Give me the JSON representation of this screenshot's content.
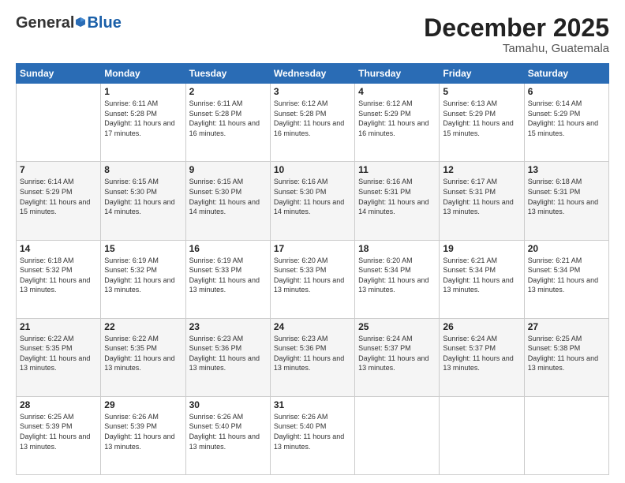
{
  "header": {
    "logo_general": "General",
    "logo_blue": "Blue",
    "month_title": "December 2025",
    "location": "Tamahu, Guatemala"
  },
  "days_of_week": [
    "Sunday",
    "Monday",
    "Tuesday",
    "Wednesday",
    "Thursday",
    "Friday",
    "Saturday"
  ],
  "weeks": [
    [
      {
        "day": "",
        "sunrise": "",
        "sunset": "",
        "daylight": ""
      },
      {
        "day": "1",
        "sunrise": "Sunrise: 6:11 AM",
        "sunset": "Sunset: 5:28 PM",
        "daylight": "Daylight: 11 hours and 17 minutes."
      },
      {
        "day": "2",
        "sunrise": "Sunrise: 6:11 AM",
        "sunset": "Sunset: 5:28 PM",
        "daylight": "Daylight: 11 hours and 16 minutes."
      },
      {
        "day": "3",
        "sunrise": "Sunrise: 6:12 AM",
        "sunset": "Sunset: 5:28 PM",
        "daylight": "Daylight: 11 hours and 16 minutes."
      },
      {
        "day": "4",
        "sunrise": "Sunrise: 6:12 AM",
        "sunset": "Sunset: 5:29 PM",
        "daylight": "Daylight: 11 hours and 16 minutes."
      },
      {
        "day": "5",
        "sunrise": "Sunrise: 6:13 AM",
        "sunset": "Sunset: 5:29 PM",
        "daylight": "Daylight: 11 hours and 15 minutes."
      },
      {
        "day": "6",
        "sunrise": "Sunrise: 6:14 AM",
        "sunset": "Sunset: 5:29 PM",
        "daylight": "Daylight: 11 hours and 15 minutes."
      }
    ],
    [
      {
        "day": "7",
        "sunrise": "Sunrise: 6:14 AM",
        "sunset": "Sunset: 5:29 PM",
        "daylight": "Daylight: 11 hours and 15 minutes."
      },
      {
        "day": "8",
        "sunrise": "Sunrise: 6:15 AM",
        "sunset": "Sunset: 5:30 PM",
        "daylight": "Daylight: 11 hours and 14 minutes."
      },
      {
        "day": "9",
        "sunrise": "Sunrise: 6:15 AM",
        "sunset": "Sunset: 5:30 PM",
        "daylight": "Daylight: 11 hours and 14 minutes."
      },
      {
        "day": "10",
        "sunrise": "Sunrise: 6:16 AM",
        "sunset": "Sunset: 5:30 PM",
        "daylight": "Daylight: 11 hours and 14 minutes."
      },
      {
        "day": "11",
        "sunrise": "Sunrise: 6:16 AM",
        "sunset": "Sunset: 5:31 PM",
        "daylight": "Daylight: 11 hours and 14 minutes."
      },
      {
        "day": "12",
        "sunrise": "Sunrise: 6:17 AM",
        "sunset": "Sunset: 5:31 PM",
        "daylight": "Daylight: 11 hours and 13 minutes."
      },
      {
        "day": "13",
        "sunrise": "Sunrise: 6:18 AM",
        "sunset": "Sunset: 5:31 PM",
        "daylight": "Daylight: 11 hours and 13 minutes."
      }
    ],
    [
      {
        "day": "14",
        "sunrise": "Sunrise: 6:18 AM",
        "sunset": "Sunset: 5:32 PM",
        "daylight": "Daylight: 11 hours and 13 minutes."
      },
      {
        "day": "15",
        "sunrise": "Sunrise: 6:19 AM",
        "sunset": "Sunset: 5:32 PM",
        "daylight": "Daylight: 11 hours and 13 minutes."
      },
      {
        "day": "16",
        "sunrise": "Sunrise: 6:19 AM",
        "sunset": "Sunset: 5:33 PM",
        "daylight": "Daylight: 11 hours and 13 minutes."
      },
      {
        "day": "17",
        "sunrise": "Sunrise: 6:20 AM",
        "sunset": "Sunset: 5:33 PM",
        "daylight": "Daylight: 11 hours and 13 minutes."
      },
      {
        "day": "18",
        "sunrise": "Sunrise: 6:20 AM",
        "sunset": "Sunset: 5:34 PM",
        "daylight": "Daylight: 11 hours and 13 minutes."
      },
      {
        "day": "19",
        "sunrise": "Sunrise: 6:21 AM",
        "sunset": "Sunset: 5:34 PM",
        "daylight": "Daylight: 11 hours and 13 minutes."
      },
      {
        "day": "20",
        "sunrise": "Sunrise: 6:21 AM",
        "sunset": "Sunset: 5:34 PM",
        "daylight": "Daylight: 11 hours and 13 minutes."
      }
    ],
    [
      {
        "day": "21",
        "sunrise": "Sunrise: 6:22 AM",
        "sunset": "Sunset: 5:35 PM",
        "daylight": "Daylight: 11 hours and 13 minutes."
      },
      {
        "day": "22",
        "sunrise": "Sunrise: 6:22 AM",
        "sunset": "Sunset: 5:35 PM",
        "daylight": "Daylight: 11 hours and 13 minutes."
      },
      {
        "day": "23",
        "sunrise": "Sunrise: 6:23 AM",
        "sunset": "Sunset: 5:36 PM",
        "daylight": "Daylight: 11 hours and 13 minutes."
      },
      {
        "day": "24",
        "sunrise": "Sunrise: 6:23 AM",
        "sunset": "Sunset: 5:36 PM",
        "daylight": "Daylight: 11 hours and 13 minutes."
      },
      {
        "day": "25",
        "sunrise": "Sunrise: 6:24 AM",
        "sunset": "Sunset: 5:37 PM",
        "daylight": "Daylight: 11 hours and 13 minutes."
      },
      {
        "day": "26",
        "sunrise": "Sunrise: 6:24 AM",
        "sunset": "Sunset: 5:37 PM",
        "daylight": "Daylight: 11 hours and 13 minutes."
      },
      {
        "day": "27",
        "sunrise": "Sunrise: 6:25 AM",
        "sunset": "Sunset: 5:38 PM",
        "daylight": "Daylight: 11 hours and 13 minutes."
      }
    ],
    [
      {
        "day": "28",
        "sunrise": "Sunrise: 6:25 AM",
        "sunset": "Sunset: 5:39 PM",
        "daylight": "Daylight: 11 hours and 13 minutes."
      },
      {
        "day": "29",
        "sunrise": "Sunrise: 6:26 AM",
        "sunset": "Sunset: 5:39 PM",
        "daylight": "Daylight: 11 hours and 13 minutes."
      },
      {
        "day": "30",
        "sunrise": "Sunrise: 6:26 AM",
        "sunset": "Sunset: 5:40 PM",
        "daylight": "Daylight: 11 hours and 13 minutes."
      },
      {
        "day": "31",
        "sunrise": "Sunrise: 6:26 AM",
        "sunset": "Sunset: 5:40 PM",
        "daylight": "Daylight: 11 hours and 13 minutes."
      },
      {
        "day": "",
        "sunrise": "",
        "sunset": "",
        "daylight": ""
      },
      {
        "day": "",
        "sunrise": "",
        "sunset": "",
        "daylight": ""
      },
      {
        "day": "",
        "sunrise": "",
        "sunset": "",
        "daylight": ""
      }
    ]
  ]
}
